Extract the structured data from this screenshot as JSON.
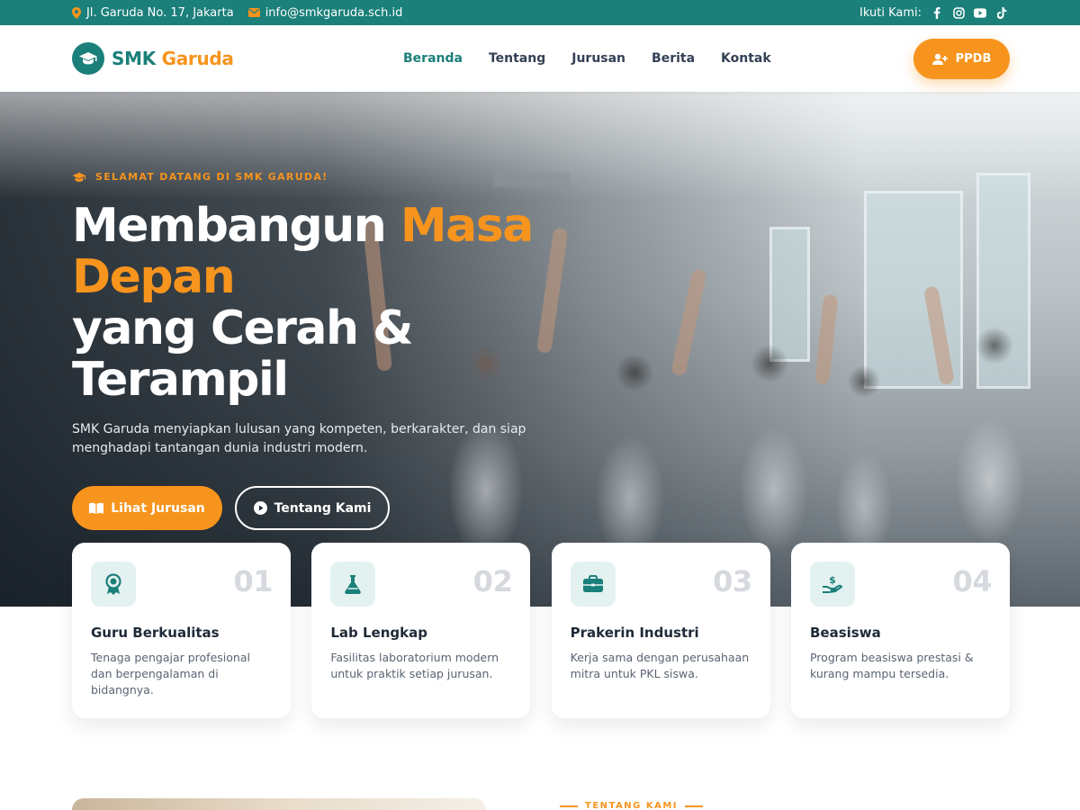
{
  "topbar": {
    "address": "Jl. Garuda No. 17, Jakarta",
    "email": "info@smkgaruda.sch.id",
    "follow_label": "Ikuti Kami:",
    "socials": [
      "facebook-icon",
      "instagram-icon",
      "youtube-icon",
      "tiktok-icon"
    ]
  },
  "header": {
    "brand_main": "SMK",
    "brand_accent": "Garuda",
    "nav": [
      {
        "label": "Beranda",
        "active": true
      },
      {
        "label": "Tentang",
        "active": false
      },
      {
        "label": "Jurusan",
        "active": false
      },
      {
        "label": "Berita",
        "active": false
      },
      {
        "label": "Kontak",
        "active": false
      }
    ],
    "cta_label": "PPDB"
  },
  "hero": {
    "eyebrow": "SELAMAT DATANG DI SMK GARUDA!",
    "headline_1": "Membangun ",
    "headline_accent": "Masa Depan",
    "headline_2": "yang Cerah &",
    "headline_3": "Terampil",
    "description": "SMK Garuda menyiapkan lulusan yang kompeten, berkarakter, dan siap menghadapi tantangan dunia industri modern.",
    "primary_button": "Lihat Jurusan",
    "secondary_button": "Tentang Kami"
  },
  "features": [
    {
      "num": "01",
      "title": "Guru Berkualitas",
      "desc": "Tenaga pengajar profesional dan berpengalaman di bidangnya.",
      "icon": "award-icon"
    },
    {
      "num": "02",
      "title": "Lab Lengkap",
      "desc": "Fasilitas laboratorium modern untuk praktik setiap jurusan.",
      "icon": "flask-icon"
    },
    {
      "num": "03",
      "title": "Prakerin Industri",
      "desc": "Kerja sama dengan perusahaan mitra untuk PKL siswa.",
      "icon": "briefcase-icon"
    },
    {
      "num": "04",
      "title": "Beasiswa",
      "desc": "Program beasiswa prestasi & kurang mampu tersedia.",
      "icon": "hand-coin-icon"
    }
  ],
  "about": {
    "tag": "TENTANG KAMI"
  },
  "colors": {
    "primary": "#1b7f7a",
    "accent": "#f7941d"
  }
}
